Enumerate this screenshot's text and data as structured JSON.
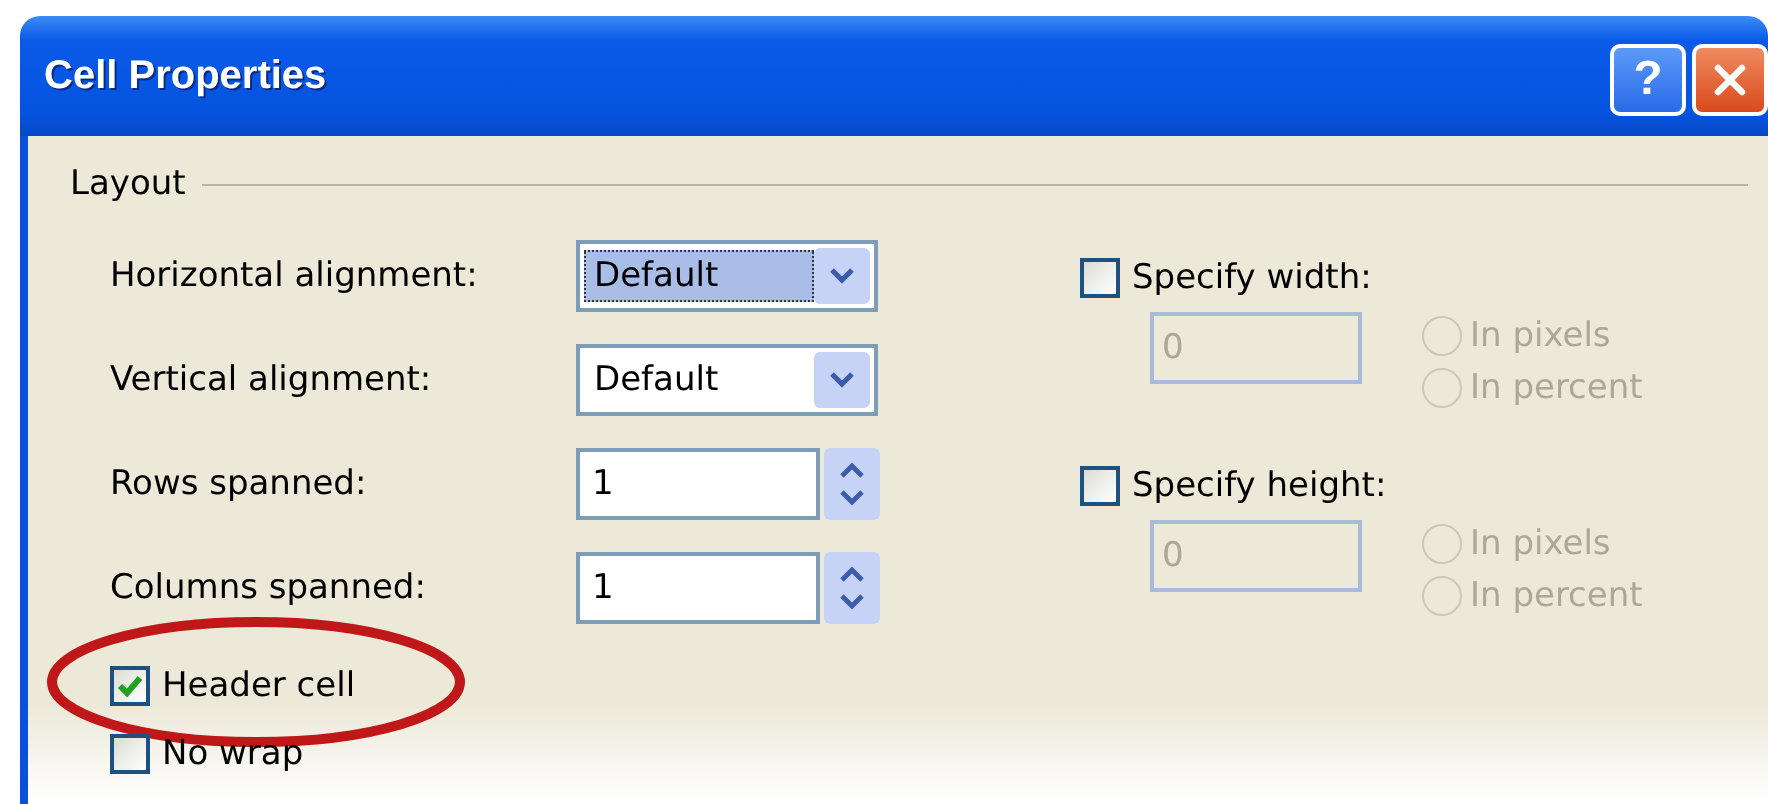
{
  "window": {
    "title": "Cell Properties",
    "help_label": "?"
  },
  "layout": {
    "title": "Layout",
    "fields": [
      {
        "kind": "combo",
        "label": "Horizontal alignment:",
        "value": "Default",
        "focused": true
      },
      {
        "kind": "combo",
        "label": "Vertical alignment:",
        "value": "Default",
        "focused": false
      },
      {
        "kind": "spin",
        "label": "Rows spanned:",
        "value": "1",
        "focused": false
      },
      {
        "kind": "spin",
        "label": "Columns spanned:",
        "value": "1",
        "focused": false
      }
    ],
    "options": [
      {
        "label": "Header cell",
        "checked": true,
        "annotated": true
      },
      {
        "label": "No wrap",
        "checked": false,
        "annotated": false
      }
    ],
    "size": [
      {
        "label": "Specify width:",
        "checked": false,
        "value": "0",
        "disabled": true,
        "units": [
          {
            "label": "In pixels",
            "selected": false
          },
          {
            "label": "In percent",
            "selected": false
          }
        ]
      },
      {
        "label": "Specify height:",
        "checked": false,
        "value": "0",
        "disabled": true,
        "units": [
          {
            "label": "In pixels",
            "selected": false
          },
          {
            "label": "In percent",
            "selected": false
          }
        ]
      }
    ]
  }
}
